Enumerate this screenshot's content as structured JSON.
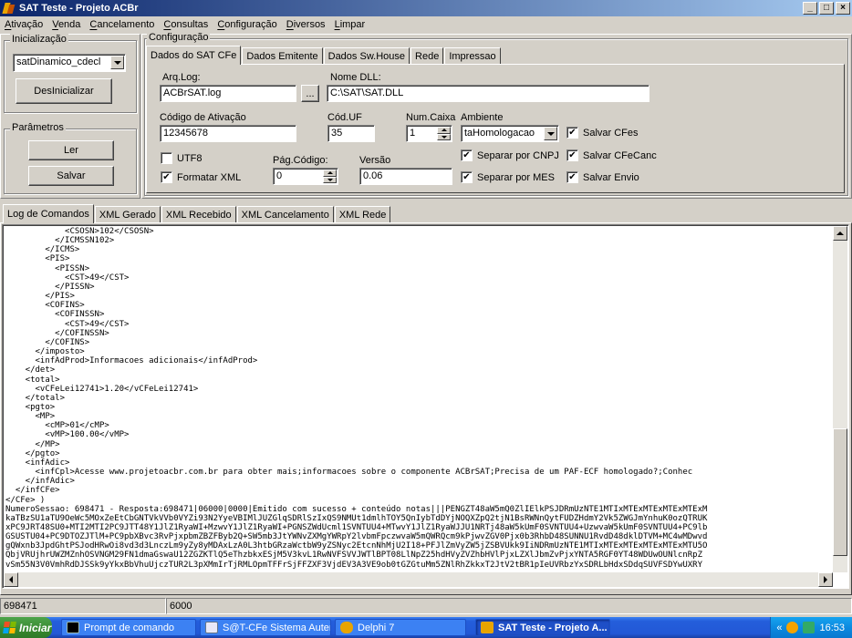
{
  "window": {
    "title": "SAT Teste - Projeto ACBr",
    "min": "_",
    "max": "□",
    "close": "×"
  },
  "menu": [
    "Ativação",
    "Venda",
    "Cancelamento",
    "Consultas",
    "Configuração",
    "Diversos",
    "Limpar"
  ],
  "init_group": {
    "title": "Inicialização",
    "model": "satDinamico_cdecl",
    "button": "DesInicializar"
  },
  "params_group": {
    "title": "Parâmetros",
    "read_label": "Ler",
    "save_label": "Salvar"
  },
  "config_group": {
    "title": "Configuração",
    "tabs": [
      "Dados do SAT CFe",
      "Dados Emitente",
      "Dados Sw.House",
      "Rede",
      "Impressao"
    ],
    "arq_log_label": "Arq.Log:",
    "arq_log": "ACBrSAT.log",
    "browse": "...",
    "dll_label": "Nome DLL:",
    "dll": "C:\\SAT\\SAT.DLL",
    "cod_ativ_label": "Código de Ativação",
    "cod_ativ": "12345678",
    "coduf_label": "Cód.UF",
    "coduf": "35",
    "numcaixa_label": "Num.Caixa",
    "numcaixa": "1",
    "ambiente_label": "Ambiente",
    "ambiente": "taHomologacao",
    "utf8_label": "UTF8",
    "pagcod_label": "Pág.Código:",
    "pagcod": "0",
    "versao_label": "Versão",
    "versao": "0.06",
    "formatar_label": "Formatar XML",
    "sep_cnpj_label": "Separar por CNPJ",
    "sep_mes_label": "Separar por MES",
    "salvar_cfes_label": "Salvar CFes",
    "salvar_cfecanc_label": "Salvar CFeCanc",
    "salvar_envio_label": "Salvar Envio"
  },
  "checked_mark": "✔",
  "log_tabs": [
    "Log de Comandos",
    "XML Gerado",
    "XML Recebido",
    "XML Cancelamento",
    "XML Rede"
  ],
  "log_text": "            <CSOSN>102</CSOSN>\n          </ICMSSN102>\n        </ICMS>\n        <PIS>\n          <PISSN>\n            <CST>49</CST>\n          </PISSN>\n        </PIS>\n        <COFINS>\n          <COFINSSN>\n            <CST>49</CST>\n          </COFINSSN>\n        </COFINS>\n      </imposto>\n      <infAdProd>Informacoes adicionais</infAdProd>\n    </det>\n    <total>\n      <vCFeLei12741>1.20</vCFeLei12741>\n    </total>\n    <pgto>\n      <MP>\n        <cMP>01</cMP>\n        <vMP>100.00</vMP>\n      </MP>\n    </pgto>\n    <infAdic>\n      <infCpl>Acesse www.projetoacbr.com.br para obter mais;informacoes sobre o componente ACBrSAT;Precisa de um PAF-ECF homologado?;Conhec\n    </infAdic>\n  </infCFe>\n</CFe> )\nNumeroSessao: 698471 - Resposta:698471|06000|0000|Emitido com sucesso + conteúdo notas|||PENGZT48aW5mQ0ZlIElkPSJDRmUzNTE1MTIxMTExMTExMTExMTExM\nkaTBzSU1aTU9OeWc5MOxZeEtCbGNTVkVVb0VYZi93N2YyeVBIMlJUZGlqSDRlSzIxQS9NMUt1dmlhTOY5QnIybTdDYjNOQXZpQ2tjN1BsRWNnQytFUDZHdmY2Vk5ZWGJmYnhuK0ozQTRUK\nxPC9JRT48SU0+MTI2MTI2PC9JTT48Y1JlZ1RyaWI+MzwvY1JlZ1RyaWI+PGNSZWdUcml1SVNTUU4+MTwvY1JlZ1RyaWJJU1NRTj48aW5kUmF0SVNTUU4+UzwvaW5kUmF0SVNTUU4+PC9lb\nGSUSTU04+PC9DTOZJTlM+PC9pbXBvc3RvPjxpbmZBZFByb2Q+SW5mb3JtYWNvZXMgYWRpY2lvbmFpczwvaW5mQWRQcm9kPjwvZGV0Pjx0b3RhbD48SUNNU1RvdD48dklDTVM+MC4wMDwvd\ngQWxnb3JpdGhtPSJodHRwOi8vd3d3LnczLm9yZy8yMDAxLzA0L3htbGRzaWctbW9yZSNyc2EtcnNhMjU2I18+PFJlZmVyZW5jZSBVUkk9IiNDRmUzNTE1MTIxMTExMTExMTExMTExMTU5O\nQbjVRUjhrUWZMZnhOSVNGM29FN1dmaGswaU12ZGZKTlQ5eThzbkxESjM5V3kvL1RwNVFSVVJWTlBPT08LlNpZ25hdHVyZVZhbHVlPjxLZXlJbmZvPjxYNTA5RGF0YT48WDUwOUNlcnRpZ\nvSm55N3V0VmhRdDJSSk9yYkxBbVhuUjczTUR2L3pXMmIrTjRMLOpmTFFrSjFFZXF3VjdEV3A3VE9ob0tGZGtuMm5ZNlRhZkkxT2JtV2tBR1pIeUVRbzYxSDRLbHdxSDdqSUVFSDYwUXRY",
  "status": {
    "left": "698471",
    "right": "6000"
  },
  "taskbar": {
    "start": "Iniciar",
    "tasks": [
      "Prompt de comando",
      "S@T-CFe Sistema Auten...",
      "Delphi 7",
      "SAT Teste - Projeto A..."
    ],
    "tray_chevron": "«",
    "clock": "16:53"
  }
}
